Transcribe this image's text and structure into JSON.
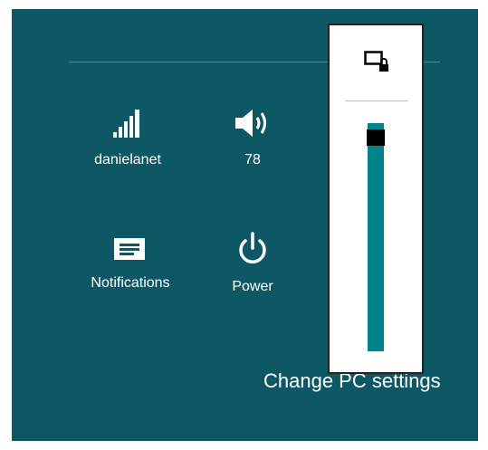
{
  "charm": {
    "tiles": [
      {
        "label": "danielanet",
        "icon": "network-signal-icon"
      },
      {
        "label": "78",
        "icon": "speaker-volume-icon"
      },
      {
        "label": "Notifications",
        "icon": "notifications-icon"
      },
      {
        "label": "Power",
        "icon": "power-icon"
      }
    ],
    "footer_link": "Change PC settings"
  },
  "flyout": {
    "icon": "rotation-lock-icon",
    "slider_value": 97
  },
  "colors": {
    "charm_background": "#0e5866",
    "slider_fill": "#00838a",
    "flyout_background": "#ffffff"
  }
}
